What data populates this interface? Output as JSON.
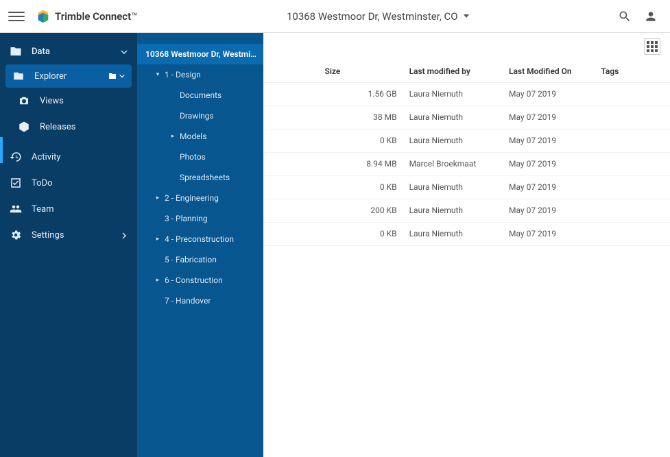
{
  "header": {
    "brand": "Trimble Connect",
    "project": "10368 Westmoor Dr, Westminster, CO"
  },
  "sidebar": {
    "data": "Data",
    "explorer": "Explorer",
    "views": "Views",
    "releases": "Releases",
    "activity": "Activity",
    "todo": "ToDo",
    "team": "Team",
    "settings": "Settings"
  },
  "tree": {
    "root": "10368 Westmoor Dr, Westmin...",
    "items": [
      {
        "label": "1 - Design",
        "level": 1,
        "expandable": true,
        "expanded": true
      },
      {
        "label": "Documents",
        "level": 2
      },
      {
        "label": "Drawings",
        "level": 2
      },
      {
        "label": "Models",
        "level": 2,
        "expandable": true
      },
      {
        "label": "Photos",
        "level": 2
      },
      {
        "label": "Spreadsheets",
        "level": 2
      },
      {
        "label": "2 - Engineering",
        "level": 1,
        "expandable": true
      },
      {
        "label": "3 - Planning",
        "level": 1
      },
      {
        "label": "4 - Preconstruction",
        "level": 1,
        "expandable": true
      },
      {
        "label": "5 - Fabrication",
        "level": 1
      },
      {
        "label": "6 - Construction",
        "level": 1,
        "expandable": true
      },
      {
        "label": "7 - Handover",
        "level": 1
      }
    ]
  },
  "table": {
    "columns": {
      "size": "Size",
      "by": "Last modified by",
      "on": "Last Modified On",
      "tags": "Tags"
    },
    "rows": [
      {
        "size": "1.56 GB",
        "by": "Laura Niemuth",
        "on": "May 07 2019"
      },
      {
        "size": "38 MB",
        "by": "Laura Niemuth",
        "on": "May 07 2019"
      },
      {
        "size": "0 KB",
        "by": "Laura Niemuth",
        "on": "May 07 2019"
      },
      {
        "size": "8.94 MB",
        "by": "Marcel Broekmaat",
        "on": "May 07 2019"
      },
      {
        "size": "0 KB",
        "by": "Laura Niemuth",
        "on": "May 07 2019"
      },
      {
        "size": "200 KB",
        "by": "Laura Niemuth",
        "on": "May 07 2019"
      },
      {
        "size": "0 KB",
        "by": "Laura Niemuth",
        "on": "May 07 2019"
      }
    ]
  }
}
